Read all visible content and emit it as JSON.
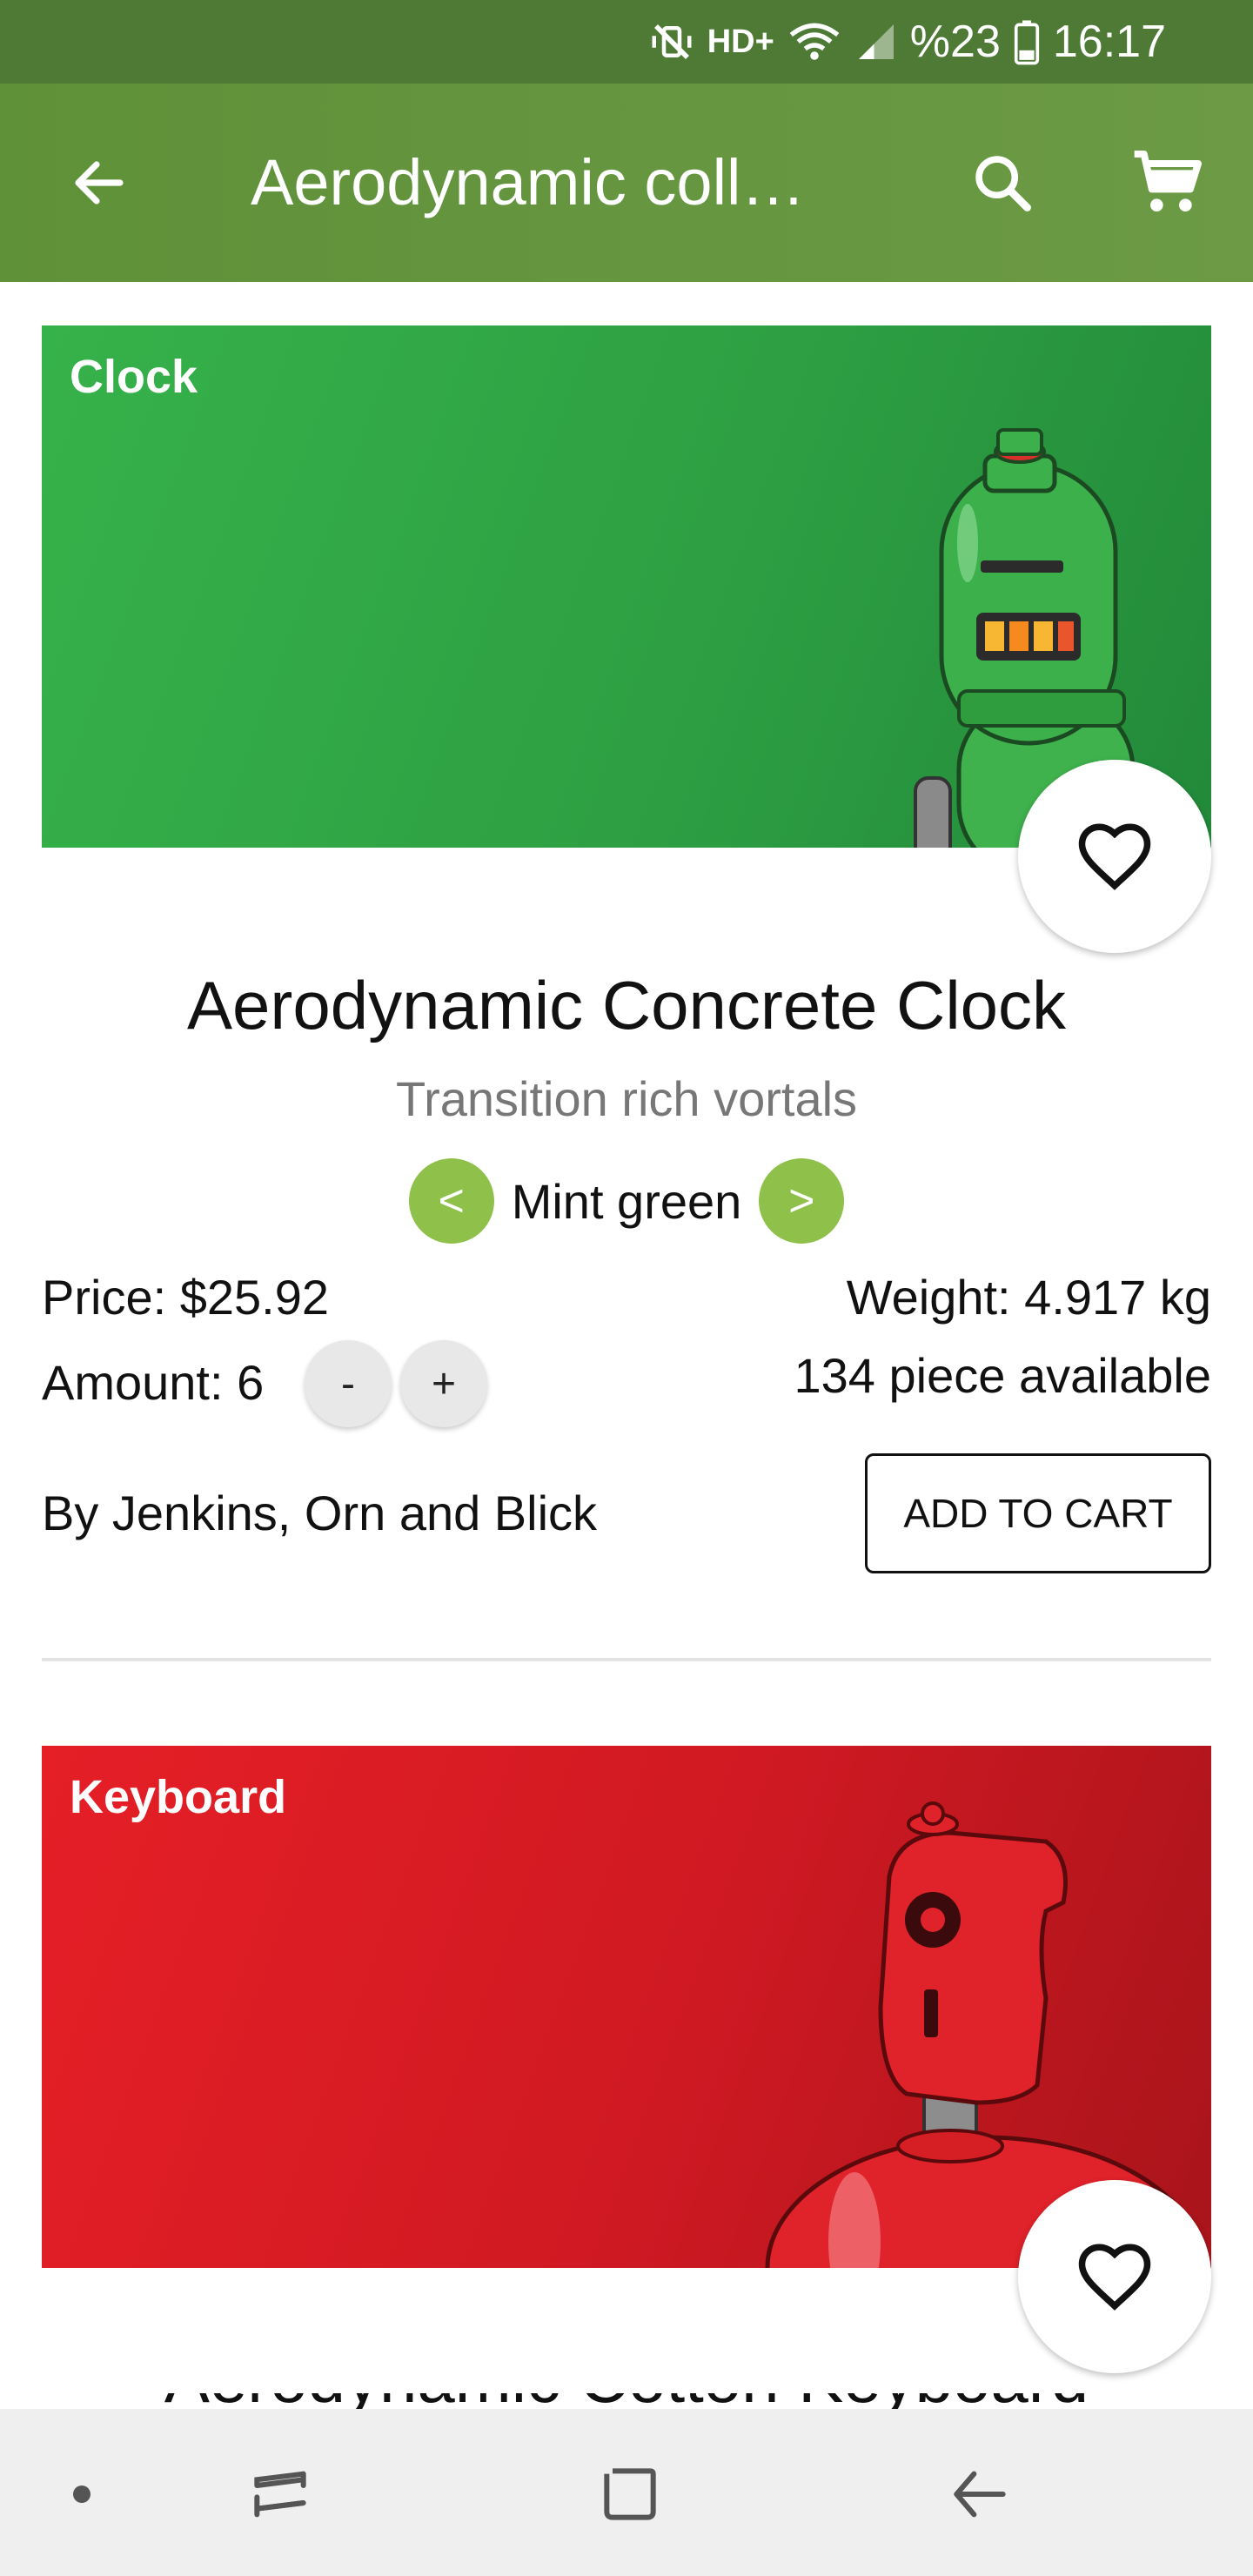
{
  "status_bar": {
    "network": "HD+",
    "battery": "%23",
    "time": "16:17"
  },
  "app_bar": {
    "title": "Aerodynamic coll…",
    "icons": [
      "back-arrow-icon",
      "search-icon",
      "cart-icon"
    ]
  },
  "products": [
    {
      "category": "Clock",
      "image_color": "#2ea043",
      "title": "Aerodynamic Concrete Clock",
      "subtitle": "Transition rich vortals",
      "variant": "Mint green",
      "variant_prev": "<",
      "variant_next": ">",
      "price": "Price: $25.92",
      "weight": "Weight: 4.917 kg",
      "amount": "Amount: 6",
      "qty_minus": "-",
      "qty_plus": "+",
      "available": "134 piece available",
      "vendor": "By Jenkins, Orn and Blick",
      "add_to_cart": "ADD TO CART"
    },
    {
      "category": "Keyboard",
      "image_color": "#cf1922",
      "title": "Aerodynamic Cotton Keyboard"
    }
  ],
  "colors": {
    "status_bar": "#4e7a35",
    "app_bar": "#6c9a45",
    "variant_button": "#8fc04a"
  },
  "nav_bar": {
    "icons": [
      "dot-icon",
      "recents-icon",
      "home-icon",
      "back-icon"
    ]
  }
}
